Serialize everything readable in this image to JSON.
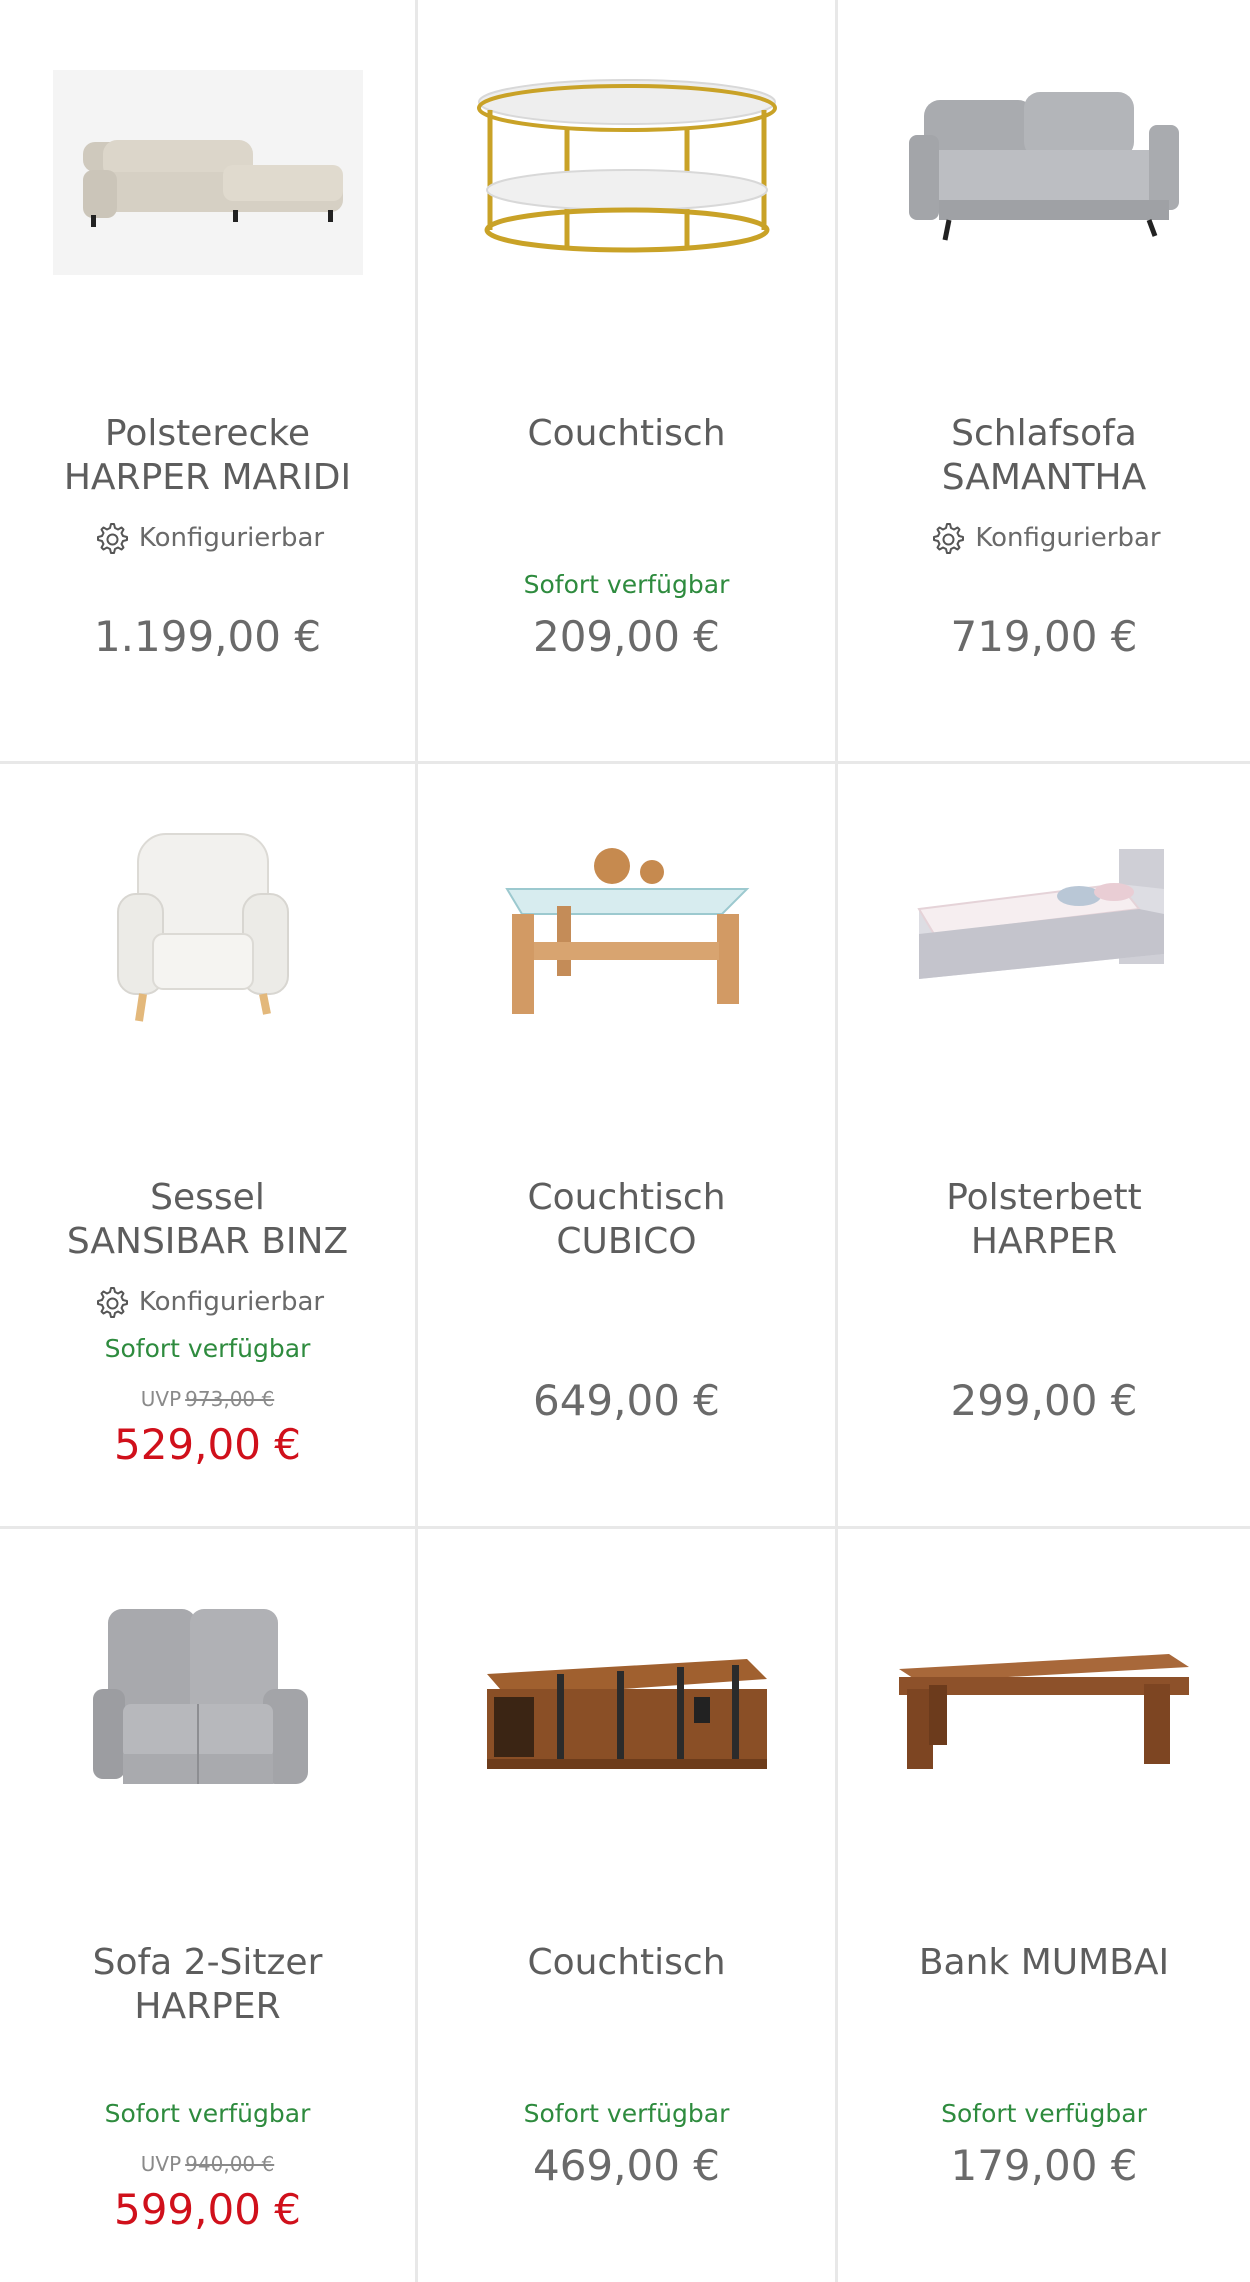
{
  "products": [
    {
      "title_lines": [
        "Polsterecke",
        "HARPER MARIDI"
      ],
      "configurable": "Konfigurierbar",
      "availability": "",
      "uvp_label": "",
      "uvp_price": "",
      "price": "1.199,00 €",
      "sale": false,
      "image": "corner-sofa-beige"
    },
    {
      "title_lines": [
        "Couchtisch",
        ""
      ],
      "configurable": "",
      "availability": "Sofort verfügbar",
      "uvp_label": "",
      "uvp_price": "",
      "price": "209,00 €",
      "sale": false,
      "image": "oval-coffee-table-marble-gold"
    },
    {
      "title_lines": [
        "Schlafsofa",
        "SAMANTHA"
      ],
      "configurable": "Konfigurierbar",
      "availability": "",
      "uvp_label": "",
      "uvp_price": "",
      "price": "719,00 €",
      "sale": false,
      "image": "sofa-bed-grey"
    },
    {
      "title_lines": [
        "Sessel",
        "SANSIBAR BINZ"
      ],
      "configurable": "Konfigurierbar",
      "availability": "Sofort verfügbar",
      "uvp_label": "UVP",
      "uvp_price": "973,00 €",
      "price": "529,00 €",
      "sale": true,
      "image": "wingback-armchair-white"
    },
    {
      "title_lines": [
        "Couchtisch",
        "CUBICO"
      ],
      "configurable": "",
      "availability": "",
      "uvp_label": "",
      "uvp_price": "",
      "price": "649,00 €",
      "sale": false,
      "image": "glass-coffee-table-wood"
    },
    {
      "title_lines": [
        "Polsterbett",
        "HARPER"
      ],
      "configurable": "",
      "availability": "",
      "uvp_label": "",
      "uvp_price": "",
      "price": "299,00 €",
      "sale": false,
      "image": "upholstered-bed-grey"
    },
    {
      "title_lines": [
        "Sofa 2-Sitzer",
        "HARPER"
      ],
      "configurable": "",
      "availability": "Sofort verfügbar",
      "uvp_label": "UVP",
      "uvp_price": "940,00 €",
      "price": "599,00 €",
      "sale": true,
      "image": "recliner-sofa-grey"
    },
    {
      "title_lines": [
        "Couchtisch",
        ""
      ],
      "configurable": "",
      "availability": "Sofort verfügbar",
      "uvp_label": "",
      "uvp_price": "",
      "price": "469,00 €",
      "sale": false,
      "image": "wooden-chest-table"
    },
    {
      "title_lines": [
        "Bank MUMBAI",
        ""
      ],
      "configurable": "",
      "availability": "Sofort verfügbar",
      "uvp_label": "",
      "uvp_price": "",
      "price": "179,00 €",
      "sale": false,
      "image": "wooden-bench"
    }
  ],
  "colors": {
    "available_green": "#2e8b3e",
    "sale_red": "#d0101b",
    "text_grey": "#5d5d5d",
    "divider": "#e8e8e8"
  }
}
